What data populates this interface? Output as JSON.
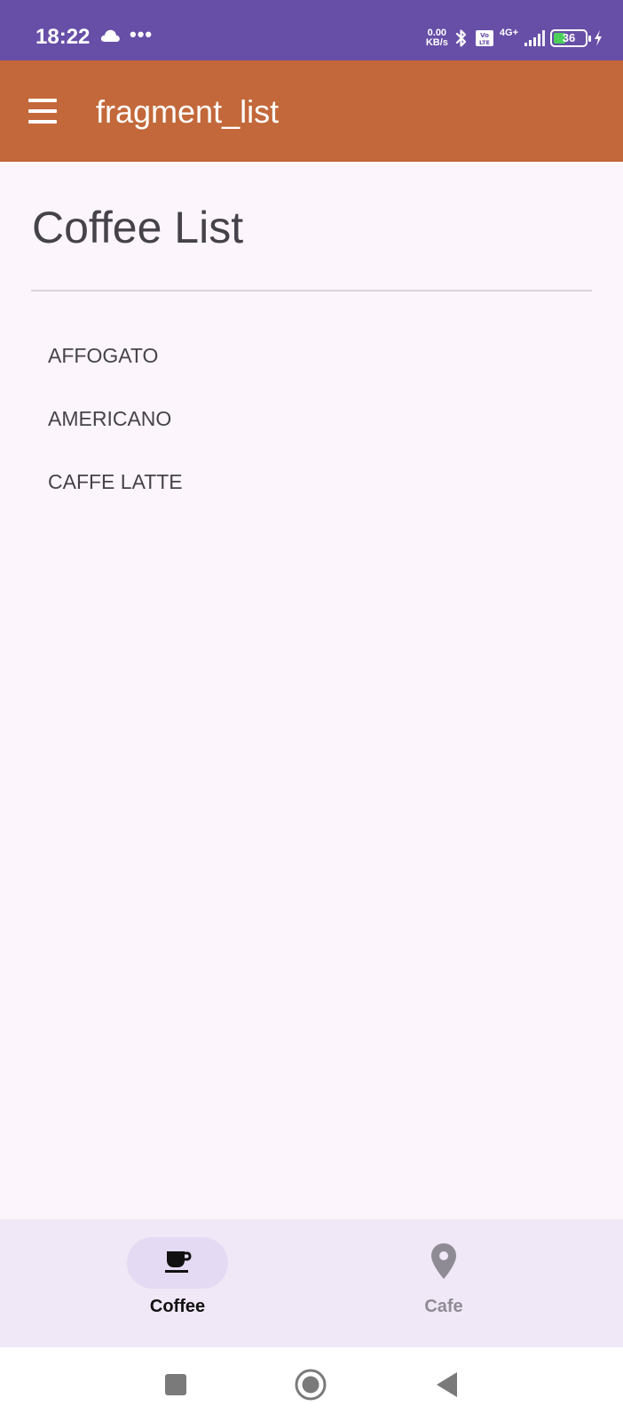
{
  "status_bar": {
    "time": "18:22",
    "net_speed_value": "0.00",
    "net_speed_unit": "KB/s",
    "network_gen": "4G+",
    "battery_level": "36",
    "more_indicator": "•••",
    "background_color": "#674ea7"
  },
  "app_bar": {
    "title": "fragment_list",
    "background_color": "#c3683a",
    "menu_icon": "hamburger-menu-icon"
  },
  "content": {
    "page_title": "Coffee List",
    "coffees": [
      {
        "label": "AFFOGATO"
      },
      {
        "label": "AMERICANO"
      },
      {
        "label": "CAFFE LATTE"
      }
    ]
  },
  "bottom_nav": {
    "items": [
      {
        "label": "Coffee",
        "icon": "coffee-cup-icon",
        "selected": true
      },
      {
        "label": "Cafe",
        "icon": "location-pin-icon",
        "selected": false
      }
    ]
  },
  "system_nav": {
    "buttons": [
      "recents-button",
      "home-button",
      "back-button"
    ]
  }
}
